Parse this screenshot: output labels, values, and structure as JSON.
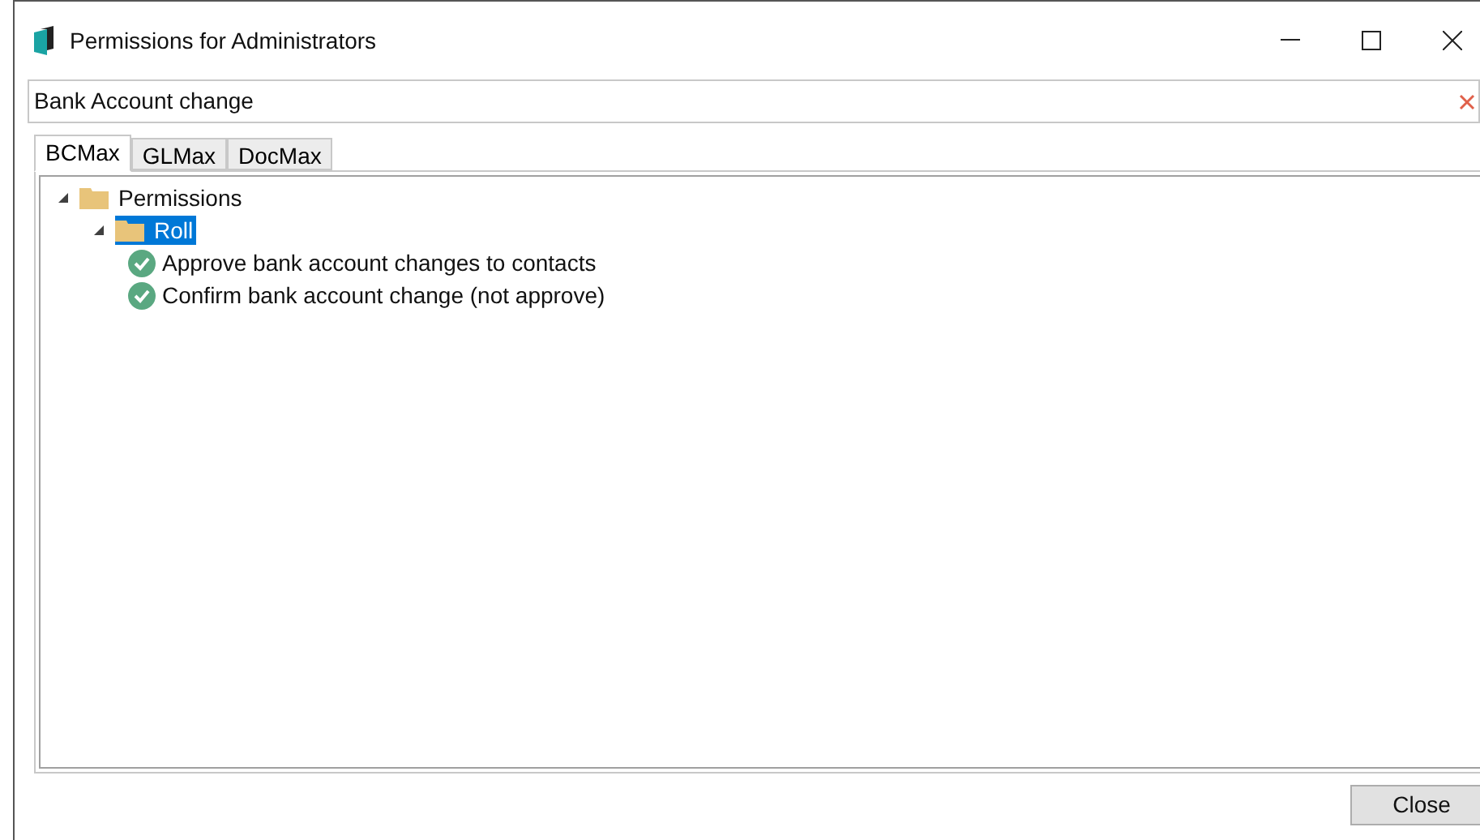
{
  "window": {
    "title": "Permissions for Administrators"
  },
  "search": {
    "value": "Bank Account change"
  },
  "tabs": [
    {
      "label": "BCMax",
      "selected": true
    },
    {
      "label": "GLMax",
      "selected": false
    },
    {
      "label": "DocMax",
      "selected": false
    }
  ],
  "tree": [
    {
      "kind": "folder",
      "label": "Permissions",
      "expanded": true,
      "selected": false,
      "children": [
        {
          "kind": "folder",
          "label": "Roll",
          "expanded": true,
          "selected": true,
          "children": [
            {
              "kind": "permission",
              "label": "Approve bank account changes to contacts",
              "selected": false
            },
            {
              "kind": "permission",
              "label": "Confirm bank account change (not approve)",
              "selected": false
            }
          ]
        }
      ]
    }
  ],
  "buttons": [
    {
      "label": "Close"
    }
  ]
}
